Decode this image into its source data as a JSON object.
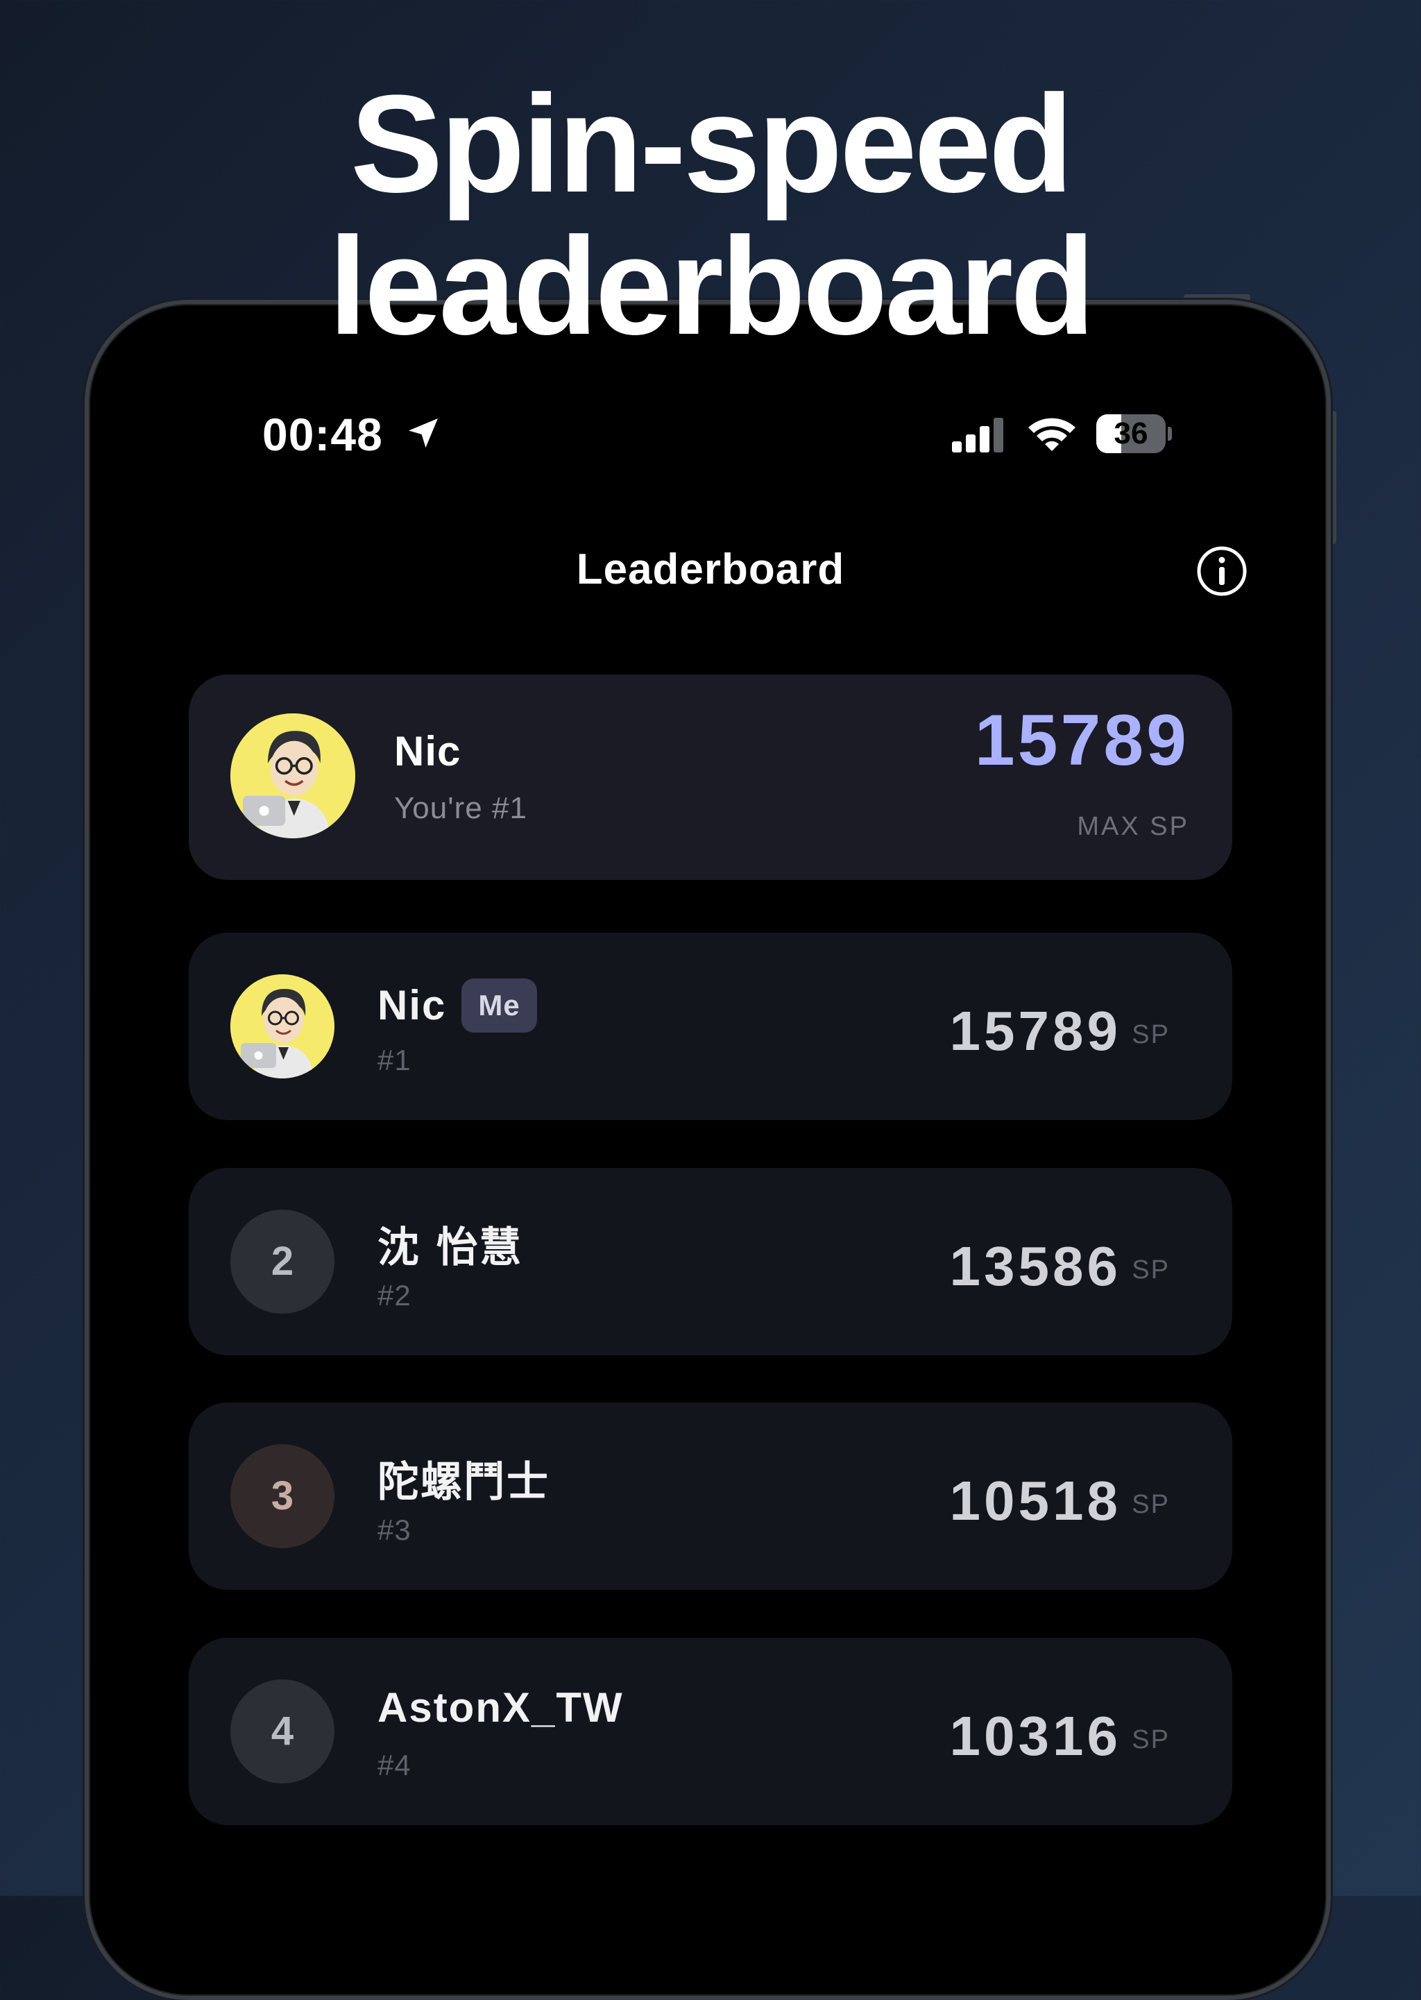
{
  "headline": {
    "line1": "Spin-speed",
    "line2": "leaderboard"
  },
  "status_bar": {
    "time": "00:48",
    "battery_level": "36",
    "battery_fraction": 0.36,
    "icons": [
      "location-arrow-icon",
      "cellular-signal-icon",
      "wifi-icon",
      "battery-icon"
    ]
  },
  "nav": {
    "title": "Leaderboard",
    "info_icon": "info-icon"
  },
  "hero": {
    "name": "Nic",
    "subtitle": "You're #1",
    "score": "15789",
    "unit": "MAX SP"
  },
  "rows": [
    {
      "name": "Nic",
      "badge": "Me",
      "rank_label": "#1",
      "score": "15789",
      "unit": "SP",
      "avatar": "user-avatar"
    },
    {
      "rank": "2",
      "name": "沈 怡慧",
      "rank_label": "#2",
      "score": "13586",
      "unit": "SP"
    },
    {
      "rank": "3",
      "name": "陀螺鬥士",
      "rank_label": "#3",
      "score": "10518",
      "unit": "SP"
    },
    {
      "rank": "4",
      "name": "AstonX_TW",
      "rank_label": "#4",
      "score": "10316",
      "unit": "SP"
    }
  ],
  "colors": {
    "background_start": "#141c2b",
    "background_end": "#22364f",
    "screen": "#000000",
    "hero_card": "#1a1b25",
    "row_card": "#12151c",
    "accent_score": "#aab2ff",
    "me_pill": "#3a3d54",
    "avatar_bg": "#f5ea6c"
  }
}
